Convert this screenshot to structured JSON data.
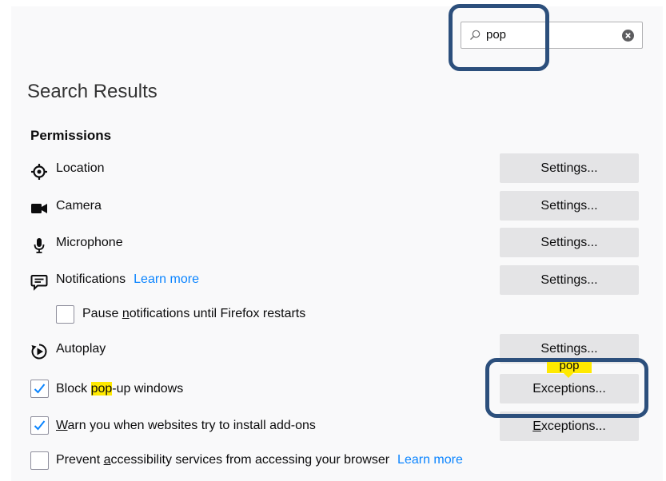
{
  "search": {
    "value": "pop"
  },
  "page": {
    "heading": "Search Results",
    "section_title": "Permissions"
  },
  "permissions": [
    {
      "label": "Location",
      "button": "Settings...",
      "icon": "location-icon"
    },
    {
      "label": "Camera",
      "button": "Settings...",
      "icon": "camera-icon"
    },
    {
      "label": "Microphone",
      "button": "Settings...",
      "icon": "microphone-icon"
    },
    {
      "label": "Notifications",
      "link": "Learn more",
      "button": "Settings...",
      "icon": "notifications-icon"
    },
    {
      "label": "Autoplay",
      "button": "Settings...",
      "icon": "autoplay-icon"
    }
  ],
  "pause_notifications": {
    "label": "Pause notifications until Firefox restarts",
    "checked": false
  },
  "block_popups": {
    "before": "Block ",
    "highlight": "pop",
    "after": "-up windows",
    "checked": true,
    "button": "Exceptions..."
  },
  "warn_addons": {
    "label": "Warn you when websites try to install add-ons",
    "checked": true,
    "button": "Exceptions..."
  },
  "prevent_accessibility": {
    "label": "Prevent accessibility services from accessing your browser",
    "link": "Learn more",
    "checked": false
  },
  "search_tooltip": "pop",
  "colors": {
    "accent": "#0a84ff",
    "highlight": "#ffe900",
    "callout": "#2c4f7c",
    "button_bg": "#e4e4e6"
  }
}
